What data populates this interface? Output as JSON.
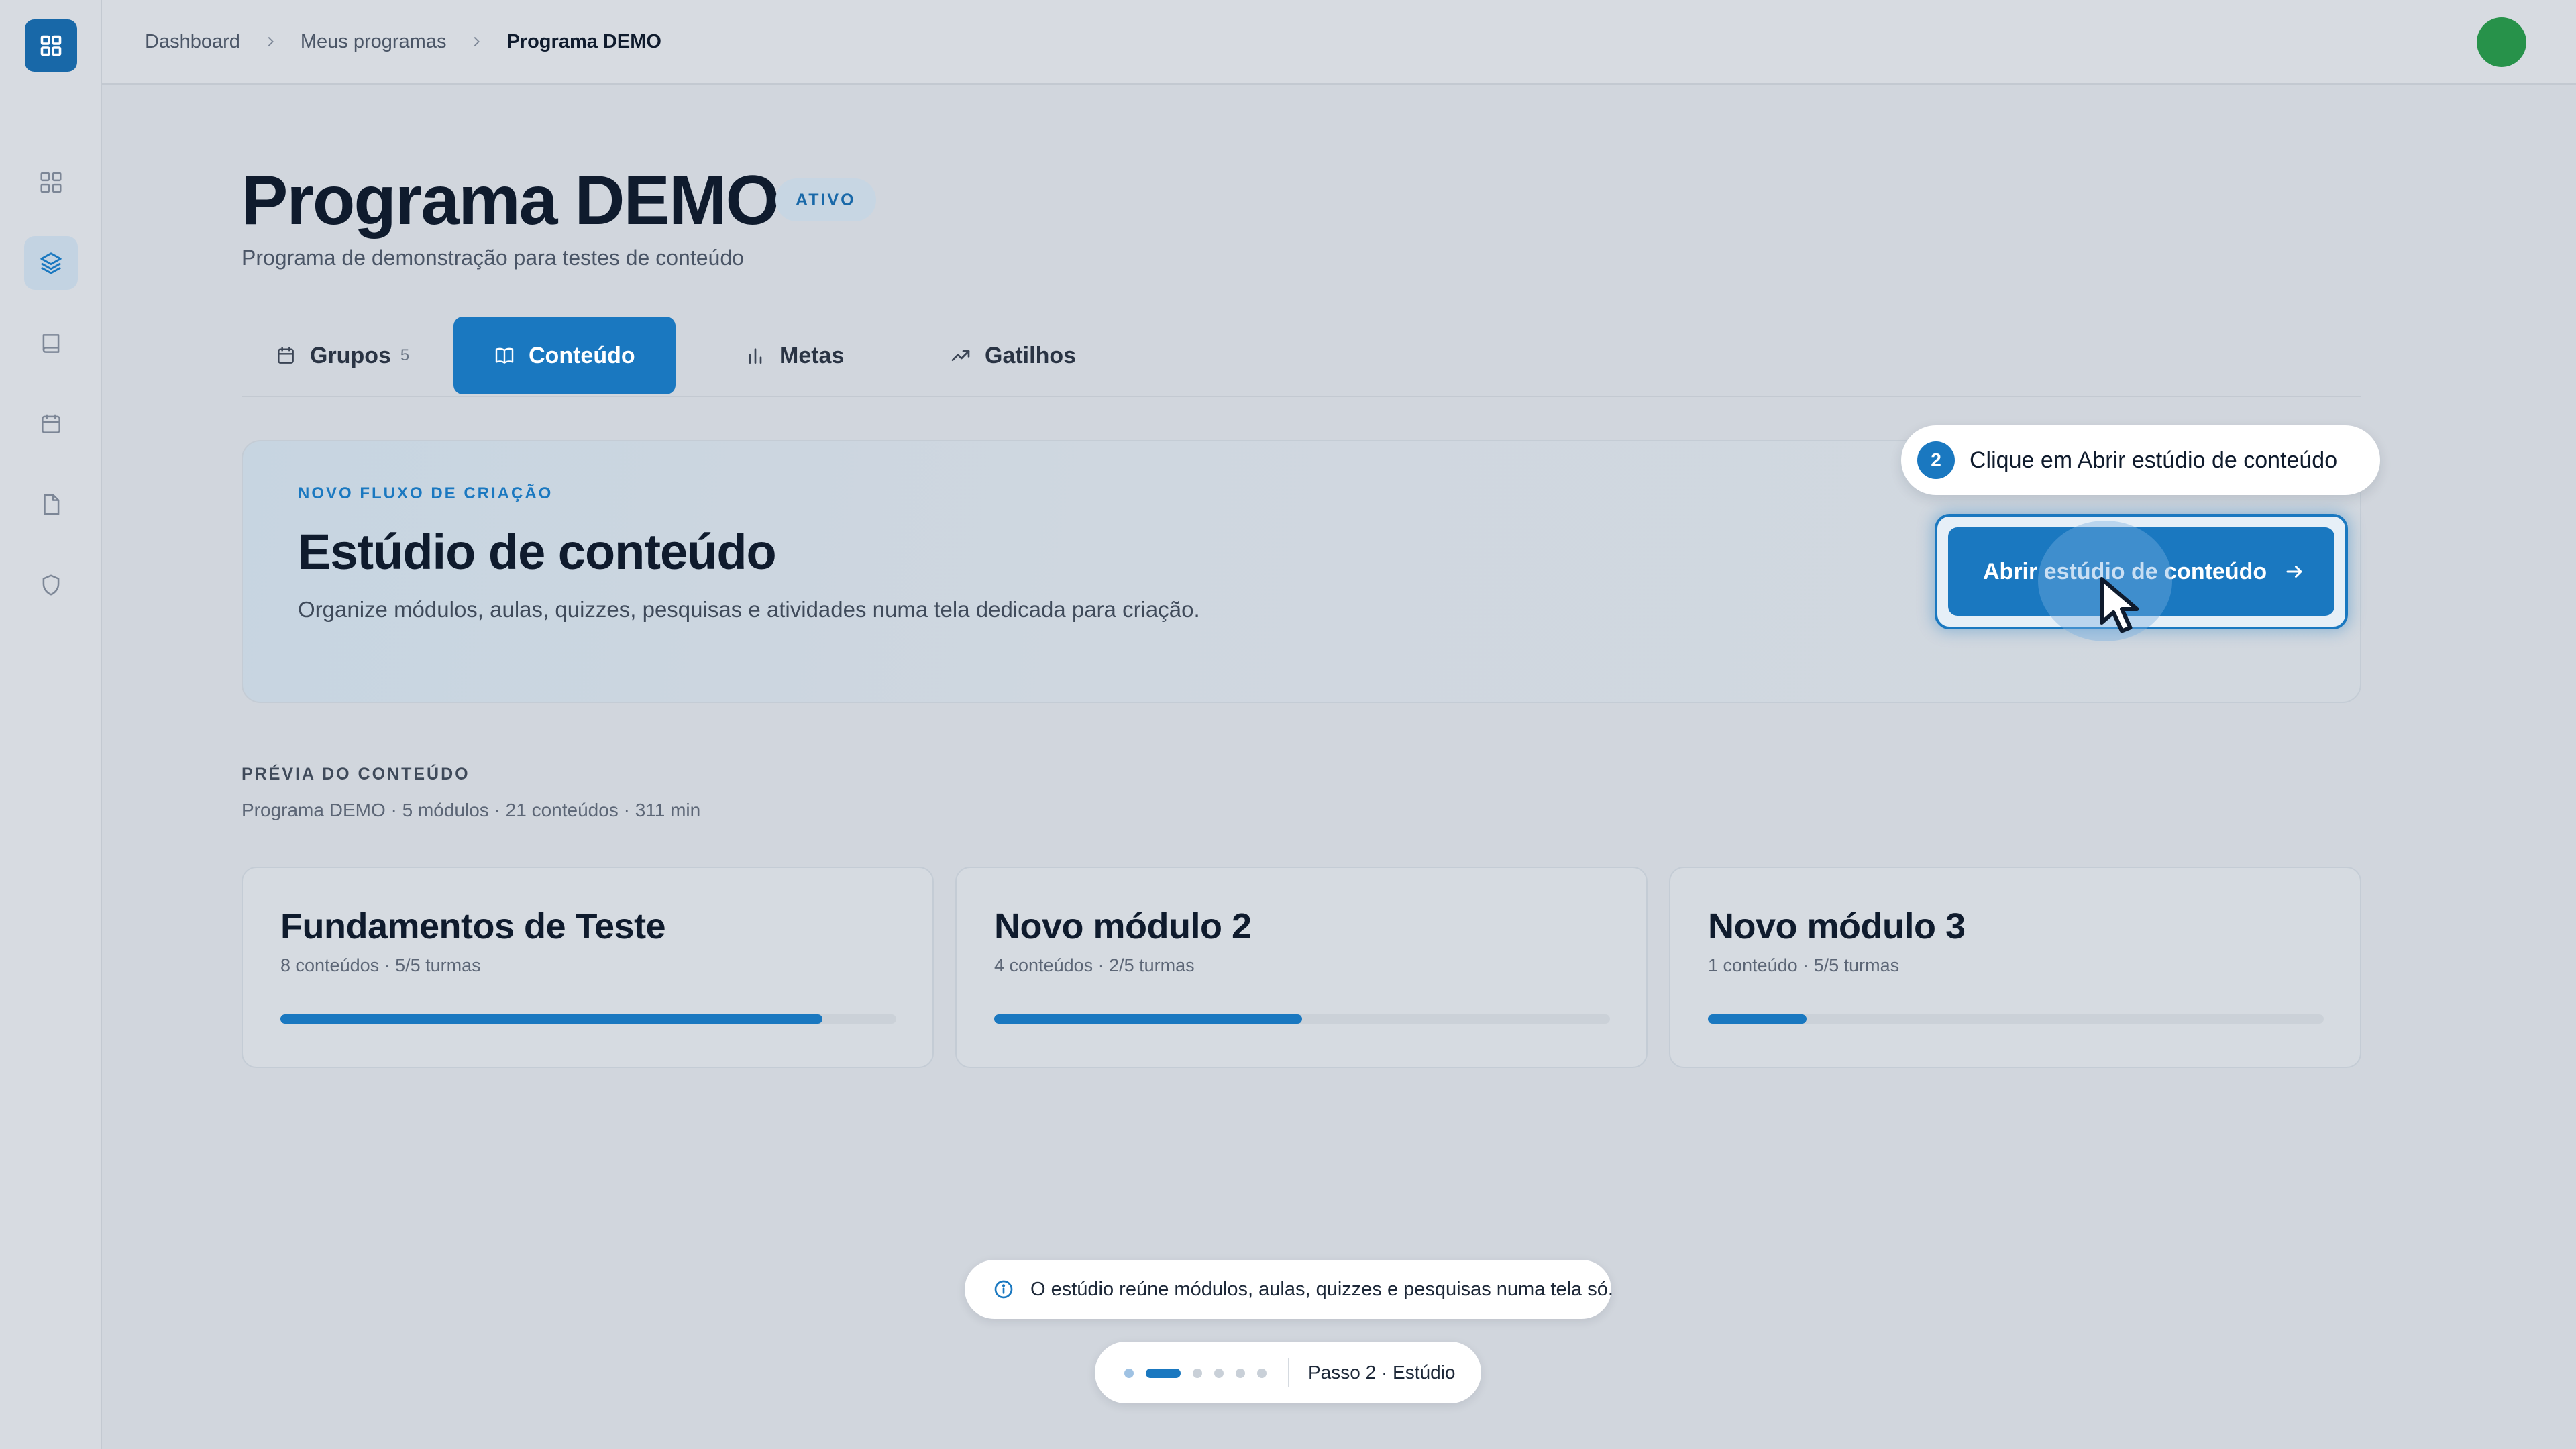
{
  "sidebar": {
    "logo_icon": "grid-icon",
    "items": [
      {
        "icon": "dashboard-icon",
        "active": false
      },
      {
        "icon": "layers-icon",
        "active": true
      },
      {
        "icon": "book-icon",
        "active": false
      },
      {
        "icon": "calendar-icon",
        "active": false
      },
      {
        "icon": "file-icon",
        "active": false
      },
      {
        "icon": "shield-icon",
        "active": false
      }
    ]
  },
  "breadcrumb": {
    "items": [
      "Dashboard",
      "Meus programas"
    ],
    "current": "Programa DEMO"
  },
  "header": {
    "title": "Programa DEMO",
    "status_badge": "ATIVO",
    "subtitle": "Programa de demonstração para testes de conteúdo"
  },
  "tabs": [
    {
      "label": "Grupos",
      "count": "5",
      "icon": "calendar-icon",
      "active": false
    },
    {
      "label": "Conteúdo",
      "icon": "book-open-icon",
      "active": true
    },
    {
      "label": "Metas",
      "icon": "bar-chart-icon",
      "active": false
    },
    {
      "label": "Gatilhos",
      "icon": "trending-up-icon",
      "active": false
    }
  ],
  "studio": {
    "eyebrow": "NOVO FLUXO DE CRIAÇÃO",
    "title": "Estúdio de conteúdo",
    "description": "Organize módulos, aulas, quizzes, pesquisas e atividades numa tela dedicada para criação.",
    "button_label": "Abrir estúdio de conteúdo"
  },
  "hint": {
    "step": "2",
    "text": "Clique em Abrir estúdio de conteúdo"
  },
  "preview": {
    "label": "PRÉVIA DO CONTEÚDO",
    "meta": "Programa DEMO · 5 módulos · 21 conteúdos · 311 min",
    "modules": [
      {
        "title": "Fundamentos de Teste",
        "meta": "8 conteúdos · 5/5 turmas",
        "progress": 0.88
      },
      {
        "title": "Novo módulo 2",
        "meta": "4 conteúdos · 2/5 turmas",
        "progress": 0.5
      },
      {
        "title": "Novo módulo 3",
        "meta": "1 conteúdo · 5/5 turmas",
        "progress": 0.16
      }
    ]
  },
  "info": {
    "icon": "info-icon",
    "text": "O estúdio reúne módulos, aulas, quizzes e pesquisas numa tela só."
  },
  "stepper": {
    "total_steps": 6,
    "current_step": 2,
    "label": "Passo 2 · Estúdio"
  },
  "colors": {
    "accent": "#1a78c0",
    "avatar": "#27924a",
    "background": "#d1d6dd"
  }
}
